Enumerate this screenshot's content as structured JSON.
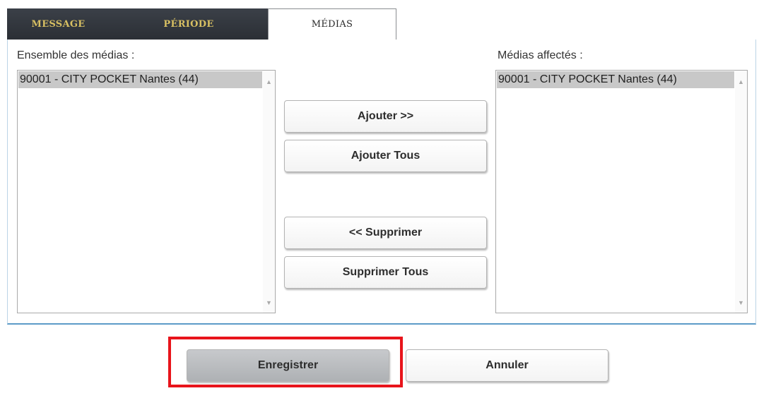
{
  "tabs": [
    {
      "label": "MESSAGE",
      "active": false
    },
    {
      "label": "PÉRIODE",
      "active": false
    },
    {
      "label": "MÉDIAS",
      "active": true
    }
  ],
  "available_media": {
    "label": "Ensemble des médias :",
    "items": [
      "90001 - CITY POCKET Nantes (44)"
    ]
  },
  "assigned_media": {
    "label": "Médias affectés :",
    "items": [
      "90001 - CITY POCKET Nantes (44)"
    ]
  },
  "transfer_buttons": {
    "add": "Ajouter >>",
    "add_all": "Ajouter Tous",
    "remove": "<< Supprimer",
    "remove_all": "Supprimer Tous"
  },
  "footer": {
    "save": "Enregistrer",
    "cancel": "Annuler"
  },
  "colors": {
    "tab_dark_bg": "#2b2f35",
    "tab_text_gold": "#d7bf62",
    "panel_border_blue": "#5c9bc8",
    "highlight_red": "#e8141b",
    "selected_item_grey": "#c8c8c8"
  },
  "icons": {
    "scroll_up": "up-arrow-icon",
    "scroll_down": "down-arrow-icon"
  }
}
